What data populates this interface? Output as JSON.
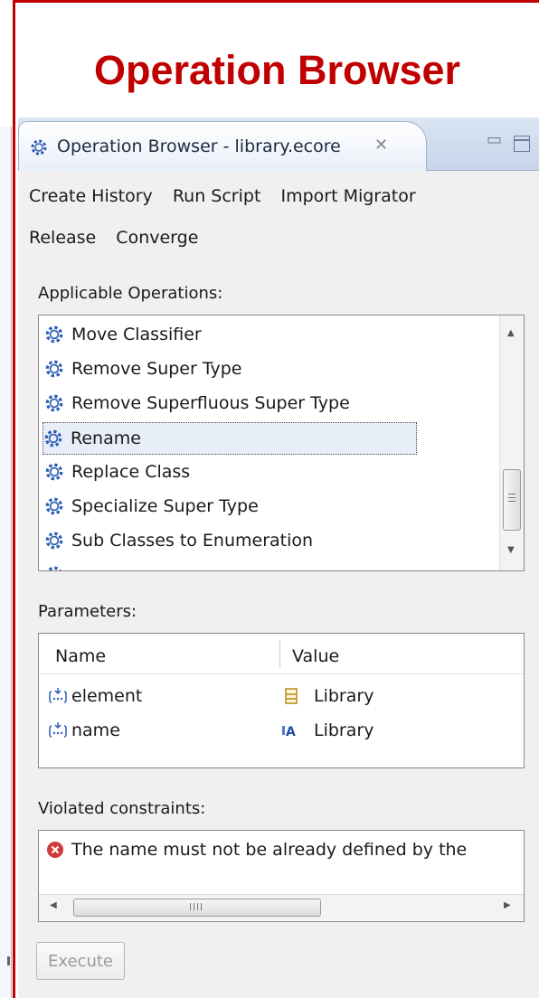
{
  "slide": {
    "title": "Operation Browser"
  },
  "view": {
    "tab_label": "Operation Browser - library.ecore",
    "tab_close": "✕"
  },
  "menu": {
    "row1": [
      "Create History",
      "Run Script",
      "Import Migrator"
    ],
    "row2": [
      "Release",
      "Converge"
    ]
  },
  "operations": {
    "label": "Applicable Operations:",
    "items": [
      "Move Classifier",
      "Remove Super Type",
      "Remove Superfluous Super Type",
      "Rename",
      "Replace Class",
      "Specialize Super Type",
      "Sub Classes to Enumeration"
    ],
    "selected": "Rename"
  },
  "parameters": {
    "label": "Parameters:",
    "columns": [
      "Name",
      "Value"
    ],
    "rows": [
      {
        "name": "element",
        "value": "Library",
        "value_icon": "class-icon"
      },
      {
        "name": "name",
        "value": "Library",
        "value_icon": "string-value-icon"
      }
    ]
  },
  "violations": {
    "label": "Violated constraints:",
    "items": [
      "The name must not be already defined by the"
    ]
  },
  "execute": {
    "label": "Execute",
    "enabled": false
  },
  "colors": {
    "title_red": "#c00000",
    "gear_blue": "#2c5db5",
    "error_red": "#d23a3a"
  }
}
